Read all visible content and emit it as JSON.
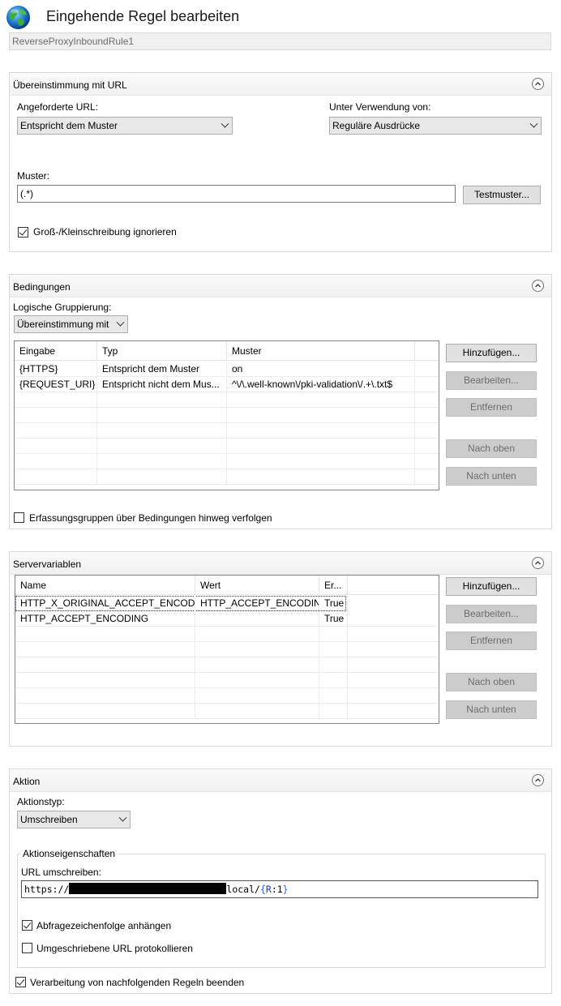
{
  "header": {
    "title": "Eingehende Regel bearbeiten",
    "rule_name": "ReverseProxyInboundRule1"
  },
  "url_match": {
    "title": "Übereinstimmung mit URL",
    "requested_url_label": "Angeforderte URL:",
    "requested_url_value": "Entspricht dem Muster",
    "using_label": "Unter Verwendung von:",
    "using_value": "Reguläre Ausdrücke",
    "pattern_label": "Muster:",
    "pattern_value": "(.*)",
    "test_button": "Testmuster...",
    "ignore_case_label": "Groß-/Kleinschreibung ignorieren",
    "ignore_case_checked": true
  },
  "conditions": {
    "title": "Bedingungen",
    "grouping_label": "Logische Gruppierung:",
    "grouping_value": "Übereinstimmung mit",
    "columns": [
      "Eingabe",
      "Typ",
      "Muster"
    ],
    "rows": [
      [
        "{HTTPS}",
        "Entspricht dem Muster",
        "on"
      ],
      [
        "{REQUEST_URI}",
        "Entspricht nicht dem Mus...",
        "^\\/\\.well-known\\/pki-validation\\/.+\\.txt$"
      ]
    ],
    "buttons": {
      "add": "Hinzufügen...",
      "edit": "Bearbeiten...",
      "remove": "Entfernen",
      "up": "Nach oben",
      "down": "Nach unten"
    },
    "track_groups_label": "Erfassungsgruppen über Bedingungen hinweg verfolgen",
    "track_groups_checked": false
  },
  "server_variables": {
    "title": "Servervariablen",
    "columns": [
      "Name",
      "Wert",
      "Er..."
    ],
    "rows": [
      [
        "HTTP_X_ORIGINAL_ACCEPT_ENCODING",
        "HTTP_ACCEPT_ENCODING",
        "True"
      ],
      [
        "HTTP_ACCEPT_ENCODING",
        "",
        "True"
      ]
    ],
    "buttons": {
      "add": "Hinzufügen...",
      "edit": "Bearbeiten...",
      "remove": "Entfernen",
      "up": "Nach oben",
      "down": "Nach unten"
    }
  },
  "action": {
    "title": "Aktion",
    "type_label": "Aktionstyp:",
    "type_value": "Umschreiben",
    "properties_legend": "Aktionseigenschaften",
    "rewrite_url_label": "URL umschreiben:",
    "rewrite_url_prefix": "https://",
    "rewrite_url_suffix": "local/",
    "rewrite_url_token_open": "{",
    "rewrite_url_token_name": "R",
    "rewrite_url_token_rest": ":1",
    "rewrite_url_token_close": "}",
    "append_query_label": "Abfragezeichenfolge anhängen",
    "append_query_checked": true,
    "log_rewritten_label": "Umgeschriebene URL protokollieren",
    "log_rewritten_checked": false,
    "stop_processing_label": "Verarbeitung von nachfolgenden Regeln beenden",
    "stop_processing_checked": true
  },
  "colors": {
    "token_brace": "#3366cc",
    "redaction": "#000000"
  },
  "icons": {
    "app": "globe-icon",
    "collapse": "chevron-up-icon",
    "dropdown": "chevron-down-icon",
    "check": "checkmark-icon"
  }
}
